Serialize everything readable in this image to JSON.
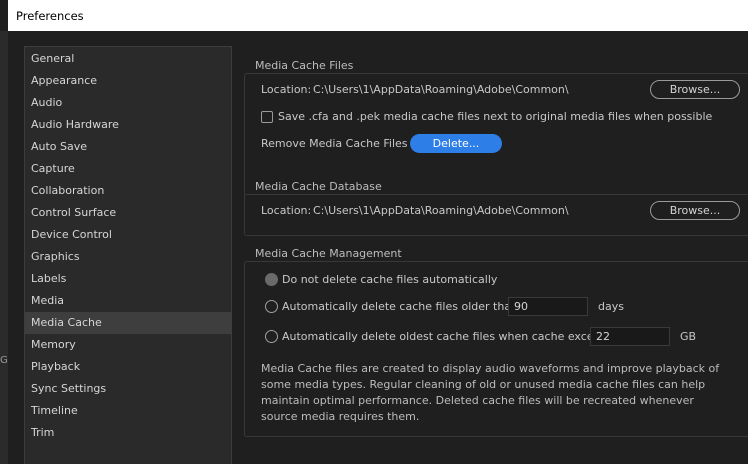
{
  "window": {
    "title": "Preferences"
  },
  "left_strip_glyph": "G",
  "sidebar": {
    "items": [
      "General",
      "Appearance",
      "Audio",
      "Audio Hardware",
      "Auto Save",
      "Capture",
      "Collaboration",
      "Control Surface",
      "Device Control",
      "Graphics",
      "Labels",
      "Media",
      "Media Cache",
      "Memory",
      "Playback",
      "Sync Settings",
      "Timeline",
      "Trim"
    ],
    "selected": "Media Cache"
  },
  "media_cache_files": {
    "title": "Media Cache Files",
    "location_label": "Location:",
    "location_value": "C:\\Users\\1\\AppData\\Roaming\\Adobe\\Common\\",
    "browse_label": "Browse...",
    "save_checkbox_label": "Save .cfa and .pek media cache files next to original media files when possible",
    "save_checked": false,
    "remove_label": "Remove Media Cache Files",
    "delete_label": "Delete..."
  },
  "media_cache_database": {
    "title": "Media Cache Database",
    "location_label": "Location:",
    "location_value": "C:\\Users\\1\\AppData\\Roaming\\Adobe\\Common\\",
    "browse_label": "Browse..."
  },
  "media_cache_management": {
    "title": "Media Cache Management",
    "option_no_delete": "Do not delete cache files automatically",
    "option_older": "Automatically delete cache files older than:",
    "older_value": "90",
    "older_unit": "days",
    "option_exceeds": "Automatically delete oldest cache files when cache exceeds:",
    "exceeds_value": "22",
    "exceeds_unit": "GB",
    "description_lines": [
      "Media Cache files are created to display audio waveforms and improve playback of",
      "some media types.  Regular cleaning of old or unused media cache files can help",
      "maintain optimal performance. Deleted cache files will be recreated whenever",
      "source media requires them."
    ]
  },
  "colors": {
    "accent": "#2d7ee6",
    "background": "#1f1f1f",
    "sidebar": "#2a2a2a",
    "selected": "#3e3e3e"
  }
}
